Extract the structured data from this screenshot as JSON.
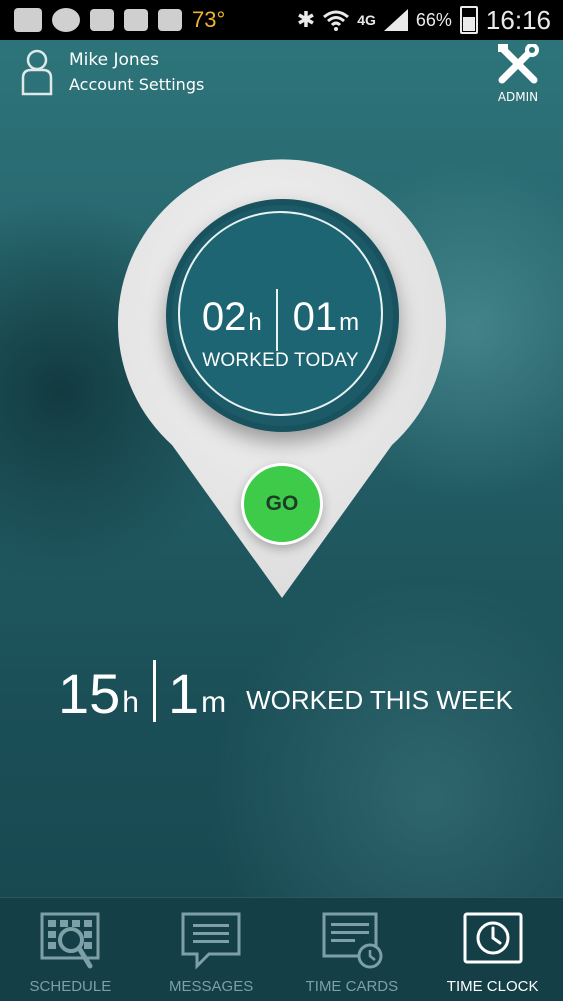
{
  "status_bar": {
    "temperature": "73°",
    "network": "4G",
    "battery": "66%",
    "time": "16:16",
    "icons": [
      "chat-icon",
      "skype-icon",
      "image-mail-icon",
      "outlook-icon",
      "gallery-icon",
      "bluetooth-icon",
      "wifi-icon",
      "signal-icon",
      "battery-icon"
    ]
  },
  "header": {
    "user_name": "Mike Jones",
    "account_link": "Account Settings",
    "admin_label": "ADMIN"
  },
  "worked_today": {
    "hours": "02",
    "hour_unit": "h",
    "minutes": "01",
    "minute_unit": "m",
    "label": "WORKED TODAY"
  },
  "go_button": {
    "label": "GO",
    "color": "#3ecb4a"
  },
  "worked_week": {
    "hours": "15",
    "hour_unit": "h",
    "minutes": "1",
    "minute_unit": "m",
    "label": "WORKED THIS WEEK"
  },
  "nav": {
    "items": [
      {
        "label": "SCHEDULE",
        "icon": "schedule-icon",
        "active": false
      },
      {
        "label": "MESSAGES",
        "icon": "messages-icon",
        "active": false
      },
      {
        "label": "TIME CARDS",
        "icon": "time-cards-icon",
        "active": false
      },
      {
        "label": "TIME CLOCK",
        "icon": "clock-icon",
        "active": true
      }
    ]
  },
  "colors": {
    "background": "#245f67",
    "timer_fill": "#1d6572",
    "pin": "#e9e9e9",
    "nav_bg": "#143f47"
  }
}
